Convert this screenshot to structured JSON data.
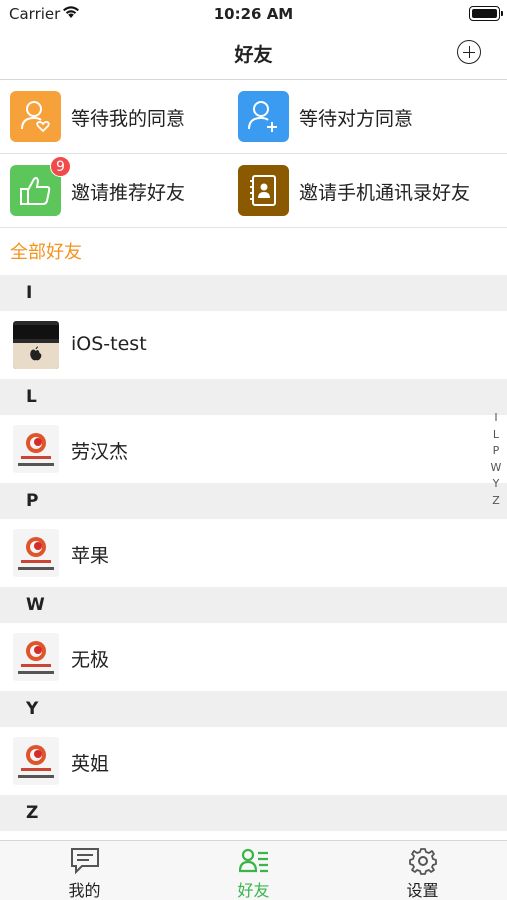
{
  "status_bar": {
    "carrier": "Carrier",
    "time": "10:26 AM"
  },
  "nav": {
    "title": "好友"
  },
  "actions": [
    {
      "label": "等待我的同意",
      "color": "#f7a13b",
      "icon": "person-heart-icon"
    },
    {
      "label": "等待对方同意",
      "color": "#3b9bf0",
      "icon": "person-add-icon"
    },
    {
      "label": "邀请推荐好友",
      "color": "#5cc65a",
      "icon": "thumbs-up-icon",
      "badge": "9"
    },
    {
      "label": "邀请手机通讯录好友",
      "color": "#8b5a00",
      "icon": "contact-book-icon"
    }
  ],
  "section_title": "全部好友",
  "groups": [
    {
      "letter": "I",
      "contacts": [
        {
          "name": "iOS-test",
          "avatar": "laptop-photo"
        }
      ]
    },
    {
      "letter": "L",
      "contacts": [
        {
          "name": "劳汉杰",
          "avatar": "logo-avatar"
        }
      ]
    },
    {
      "letter": "P",
      "contacts": [
        {
          "name": "苹果",
          "avatar": "logo-avatar"
        }
      ]
    },
    {
      "letter": "W",
      "contacts": [
        {
          "name": "无极",
          "avatar": "logo-avatar"
        }
      ]
    },
    {
      "letter": "Y",
      "contacts": [
        {
          "name": "英姐",
          "avatar": "logo-avatar"
        }
      ]
    },
    {
      "letter": "Z",
      "contacts": []
    }
  ],
  "index_letters": [
    "I",
    "L",
    "P",
    "W",
    "Y",
    "Z"
  ],
  "tabs": [
    {
      "label": "我的",
      "icon": "chat-icon",
      "active": false
    },
    {
      "label": "好友",
      "icon": "friends-list-icon",
      "active": true
    },
    {
      "label": "设置",
      "icon": "gear-icon",
      "active": false
    }
  ],
  "colors": {
    "accent": "#3ab54a",
    "section_title": "#f3931e",
    "badge": "#f24a4a"
  }
}
